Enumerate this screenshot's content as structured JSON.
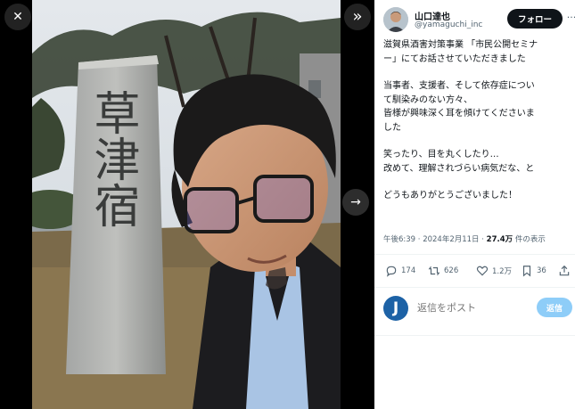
{
  "viewer": {
    "close_glyph": "✕",
    "expand_glyph": "»",
    "next_glyph": "→",
    "stone_inscription": "草津宿"
  },
  "author": {
    "name": "山口達也",
    "handle": "@yamaguchi_inc",
    "follow_label": "フォロー",
    "more_glyph": "···"
  },
  "tweet": {
    "paragraphs": [
      [
        "滋賀県酒害対策事業 「市民公開セミナ",
        "ー」にてお話させていただきました"
      ],
      [
        "当事者、支援者、そして依存症につい",
        "て馴染みのない方々、",
        "皆様が興味深く耳を傾けてくださいま",
        "した"
      ],
      [
        "笑ったり、目を丸くしたり…",
        "改めて、理解されづらい病気だな、と"
      ],
      [
        "どうもありがとうございました！"
      ]
    ]
  },
  "meta": {
    "time": "午後6:39",
    "sep": " · ",
    "date": "2024年2月11日",
    "views": "27.4万",
    "views_suffix": " 件の表示"
  },
  "actions": {
    "replies": "174",
    "reposts": "626",
    "likes": "1.2万",
    "bookmarks": "36"
  },
  "reply": {
    "avatar_letter": "J",
    "placeholder": "返信をポスト",
    "button_label": "返信"
  },
  "colors": {
    "follow_bg": "#0f1419",
    "reply_btn_bg": "#8ecdf8",
    "muted_text": "#536471",
    "accent": "#1d9bf0"
  }
}
